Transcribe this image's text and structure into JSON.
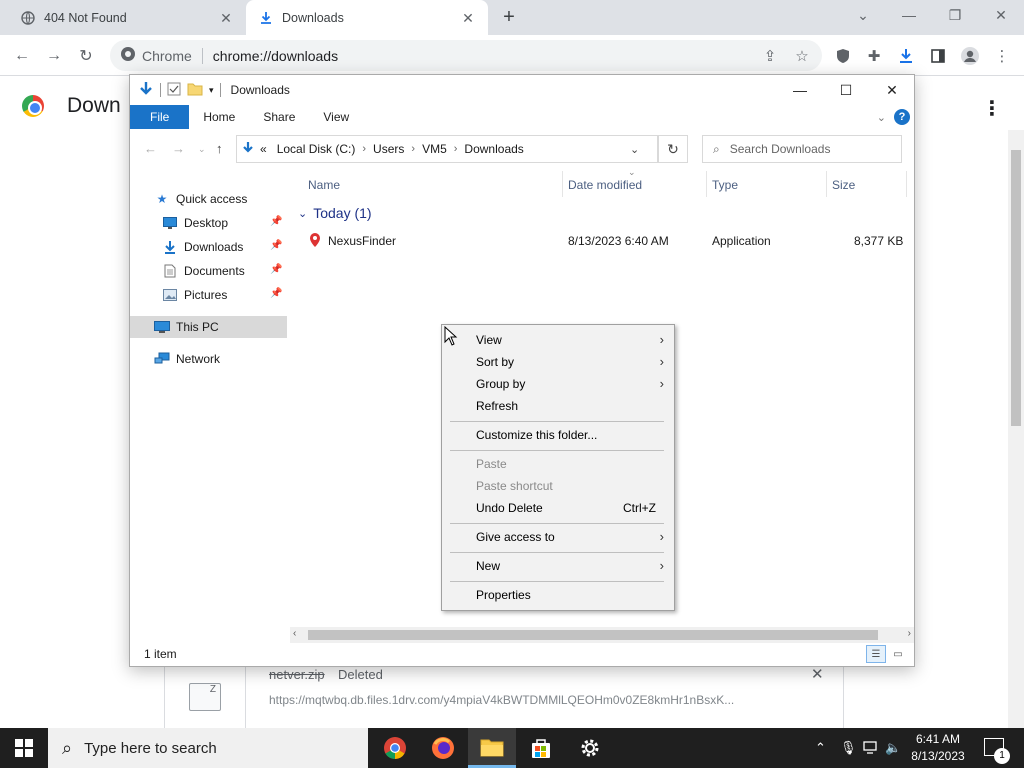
{
  "browser": {
    "tabs": [
      {
        "title": "404 Not Found",
        "icon": "globe-icon"
      },
      {
        "title": "Downloads",
        "icon": "download-icon"
      }
    ],
    "omnibox": {
      "site": "Chrome",
      "url": "chrome://downloads"
    }
  },
  "page": {
    "title": "Down",
    "download_item": {
      "filename": "netver.zip",
      "status": "Deleted",
      "url": "https://mqtwbq.db.files.1drv.com/y4mpiaV4kBWTDMMlLQEOHm0v0ZE8kmHr1nBsxK..."
    }
  },
  "explorer": {
    "title": "Downloads",
    "ribbon_tabs": [
      "File",
      "Home",
      "Share",
      "View"
    ],
    "breadcrumb": {
      "prefix": "«",
      "items": [
        "Local Disk (C:)",
        "Users",
        "VM5",
        "Downloads"
      ]
    },
    "search_placeholder": "Search Downloads",
    "nav": {
      "quick_access": "Quick access",
      "desktop": "Desktop",
      "downloads": "Downloads",
      "documents": "Documents",
      "pictures": "Pictures",
      "this_pc": "This PC",
      "network": "Network"
    },
    "columns": {
      "name": "Name",
      "date": "Date modified",
      "type": "Type",
      "size": "Size"
    },
    "group": "Today (1)",
    "file": {
      "name": "NexusFinder",
      "date": "8/13/2023 6:40 AM",
      "type": "Application",
      "size": "8,377 KB"
    },
    "status": "1 item"
  },
  "context_menu": {
    "view": "View",
    "sort_by": "Sort by",
    "group_by": "Group by",
    "refresh": "Refresh",
    "customize": "Customize this folder...",
    "paste": "Paste",
    "paste_shortcut": "Paste shortcut",
    "undo_delete": "Undo Delete",
    "undo_accel": "Ctrl+Z",
    "give_access": "Give access to",
    "new": "New",
    "properties": "Properties"
  },
  "taskbar": {
    "search_placeholder": "Type here to search",
    "time": "6:41 AM",
    "date": "8/13/2023",
    "notifications": "1"
  }
}
